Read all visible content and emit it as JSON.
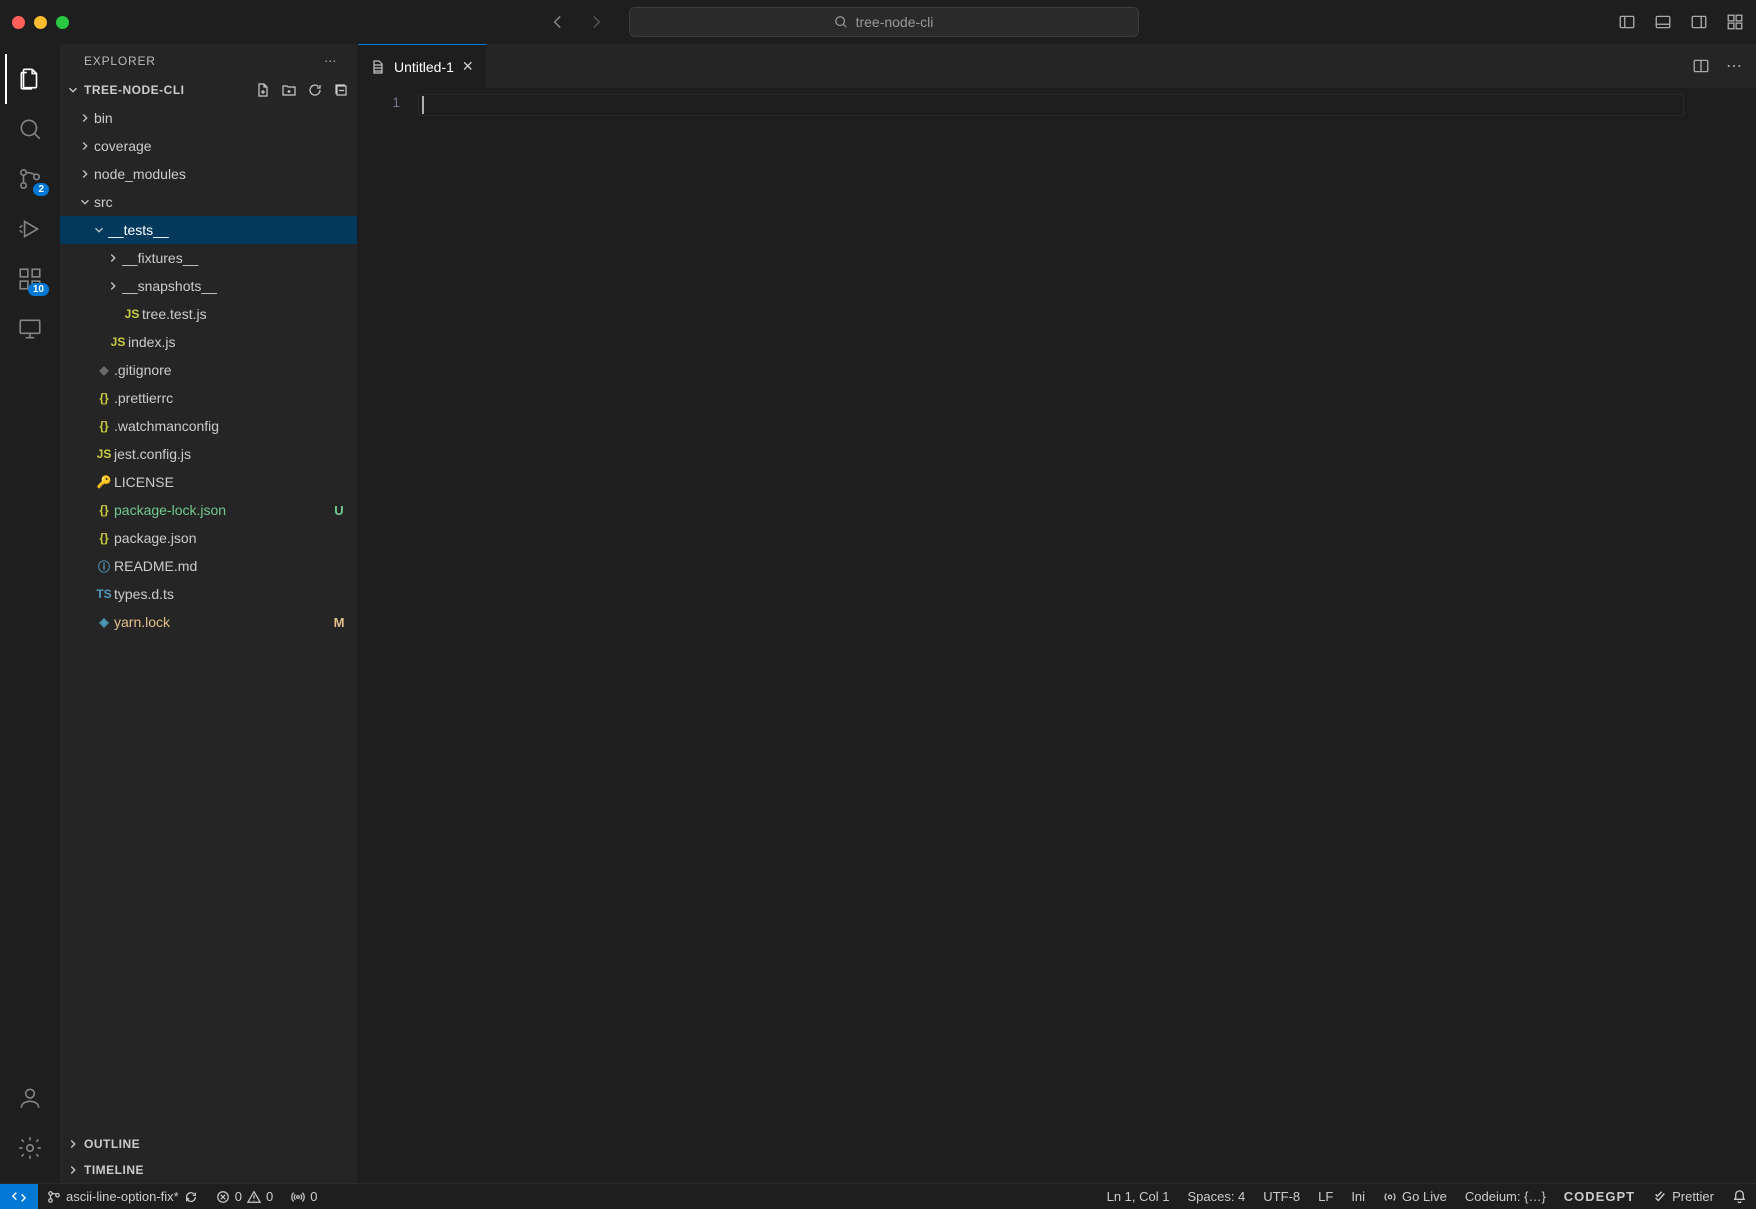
{
  "window": {
    "search_text": "tree-node-cli"
  },
  "activity": {
    "scm_badge": "2",
    "ext_badge": "10"
  },
  "explorer": {
    "title": "EXPLORER",
    "project": "TREE-NODE-CLI",
    "outline": "OUTLINE",
    "timeline": "TIMELINE",
    "tree": [
      {
        "kind": "folder",
        "name": "bin",
        "depth": 0,
        "open": false
      },
      {
        "kind": "folder",
        "name": "coverage",
        "depth": 0,
        "open": false
      },
      {
        "kind": "folder",
        "name": "node_modules",
        "depth": 0,
        "open": false
      },
      {
        "kind": "folder",
        "name": "src",
        "depth": 0,
        "open": true
      },
      {
        "kind": "folder",
        "name": "__tests__",
        "depth": 1,
        "open": true,
        "selected": true
      },
      {
        "kind": "folder",
        "name": "__fixtures__",
        "depth": 2,
        "open": false
      },
      {
        "kind": "folder",
        "name": "__snapshots__",
        "depth": 2,
        "open": false
      },
      {
        "kind": "file",
        "name": "tree.test.js",
        "depth": 2,
        "icon": "js"
      },
      {
        "kind": "file",
        "name": "index.js",
        "depth": 1,
        "icon": "js"
      },
      {
        "kind": "file",
        "name": ".gitignore",
        "depth": 0,
        "icon": "git"
      },
      {
        "kind": "file",
        "name": ".prettierrc",
        "depth": 0,
        "icon": "json"
      },
      {
        "kind": "file",
        "name": ".watchmanconfig",
        "depth": 0,
        "icon": "json"
      },
      {
        "kind": "file",
        "name": "jest.config.js",
        "depth": 0,
        "icon": "js"
      },
      {
        "kind": "file",
        "name": "LICENSE",
        "depth": 0,
        "icon": "lic"
      },
      {
        "kind": "file",
        "name": "package-lock.json",
        "depth": 0,
        "icon": "json",
        "git": "U"
      },
      {
        "kind": "file",
        "name": "package.json",
        "depth": 0,
        "icon": "json"
      },
      {
        "kind": "file",
        "name": "README.md",
        "depth": 0,
        "icon": "info"
      },
      {
        "kind": "file",
        "name": "types.d.ts",
        "depth": 0,
        "icon": "ts"
      },
      {
        "kind": "file",
        "name": "yarn.lock",
        "depth": 0,
        "icon": "yarn",
        "git": "M"
      }
    ]
  },
  "editor": {
    "tab_name": "Untitled-1",
    "line_number": "1"
  },
  "status": {
    "branch": "ascii-line-option-fix*",
    "errors": "0",
    "warnings": "0",
    "ports": "0",
    "cursor": "Ln 1, Col 1",
    "spaces": "Spaces: 4",
    "encoding": "UTF-8",
    "eol": "LF",
    "lang": "Ini",
    "live": "Go Live",
    "codeium": "Codeium: {…}",
    "codegpt": "CODEGPT",
    "prettier": "Prettier"
  }
}
